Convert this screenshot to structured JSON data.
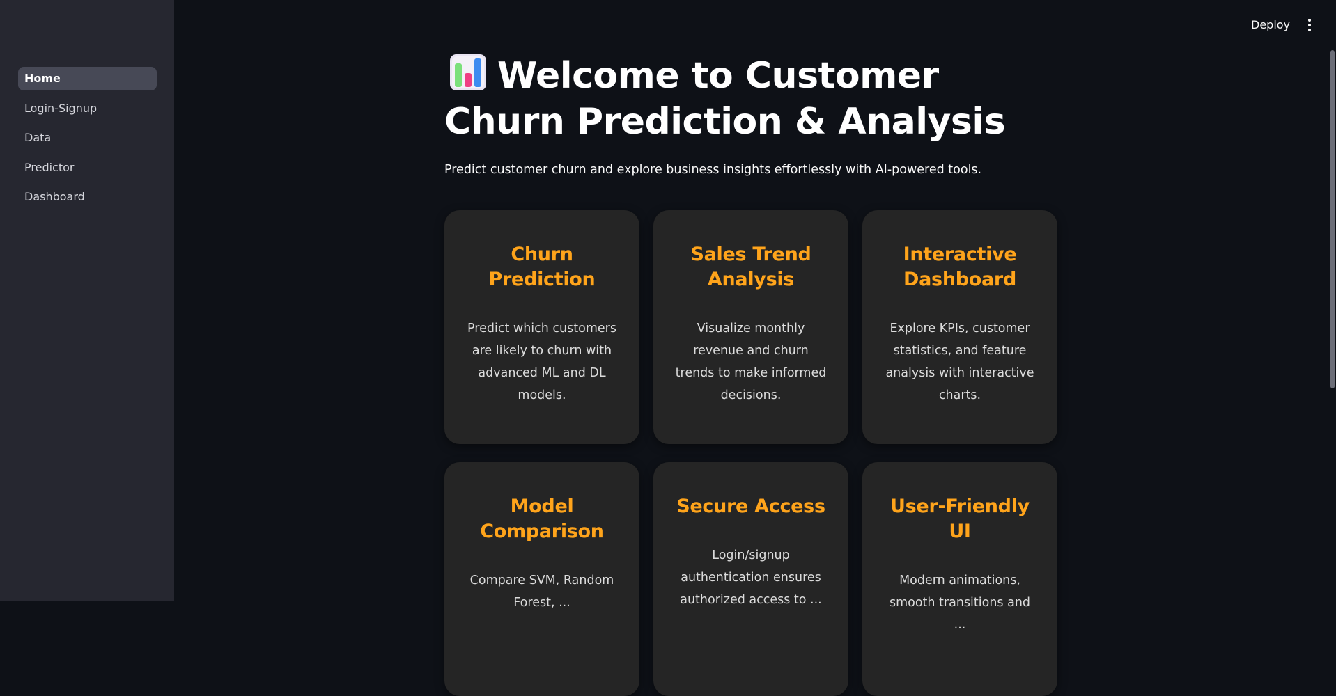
{
  "sidebar": {
    "items": [
      {
        "label": "Home",
        "active": true
      },
      {
        "label": "Login-Signup"
      },
      {
        "label": "Data"
      },
      {
        "label": "Predictor"
      },
      {
        "label": "Dashboard"
      }
    ]
  },
  "header": {
    "deploy_label": "Deploy",
    "menu_icon": "kebab-menu-icon"
  },
  "main": {
    "title_icon": "bar-chart-icon",
    "title": "Welcome to Customer Churn Prediction & Analysis",
    "subtitle": "Predict customer churn and explore business insights effortlessly with AI-powered tools.",
    "cards": [
      {
        "title": "Churn Prediction",
        "description": "Predict which customers are likely to churn with advanced ML and DL models."
      },
      {
        "title": "Sales Trend Analysis",
        "description": "Visualize monthly revenue and churn trends to make informed decisions."
      },
      {
        "title": "Interactive Dashboard",
        "description": "Explore KPIs, customer statistics, and feature analysis with interactive charts."
      },
      {
        "title": "Model Comparison",
        "description": "Compare SVM, Random Forest, ..."
      },
      {
        "title": "Secure Access",
        "description": "Login/signup authentication ensures authorized access to ..."
      },
      {
        "title": "User-Friendly UI",
        "description": "Modern animations, smooth transitions and ..."
      }
    ]
  },
  "colors": {
    "background": "#0e1117",
    "sidebar": "#262730",
    "card": "#252525",
    "accent": "#ffa41b"
  }
}
